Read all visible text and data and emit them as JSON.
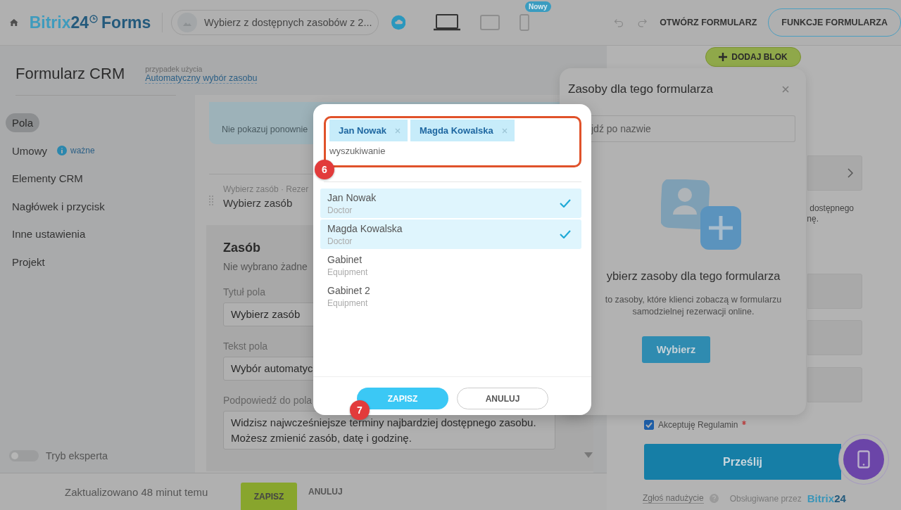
{
  "topbar": {
    "logo": {
      "brand": "Bitrix",
      "number": "24",
      "product": "Forms"
    },
    "page_select": "Wybierz z dostępnych zasobów z 2...",
    "devices": [
      {
        "kind": "laptop",
        "selected": true
      },
      {
        "kind": "tablet",
        "selected": false
      },
      {
        "kind": "phone",
        "selected": false,
        "badge": "Nowy"
      }
    ],
    "open_link": "OTWÓRZ FORMULARZ",
    "features_button": "FUNKCJE FORMULARZA"
  },
  "sidebar": {
    "title": "Formularz CRM",
    "use_case_label": "przypadek użycia",
    "use_case": "Automatyczny wybór zasobu",
    "items": [
      {
        "label": "Pola",
        "selected": true
      },
      {
        "label": "Umowy",
        "selected": false,
        "note": "ważne"
      },
      {
        "label": "Elementy CRM",
        "selected": false
      },
      {
        "label": "Nagłówek i przycisk",
        "selected": false
      },
      {
        "label": "Inne ustawienia",
        "selected": false
      },
      {
        "label": "Projekt",
        "selected": false
      }
    ],
    "expert_mode": {
      "label": "Tryb eksperta",
      "on": false
    }
  },
  "editor": {
    "notice": "Nie pokazuj ponownie",
    "field_path": "Wybierz zasób · Rezer",
    "field_name": "Wybierz zasób",
    "section": {
      "title": "Zasób",
      "subtitle": "Nie wybrano żadne",
      "fields": [
        {
          "label": "Tytuł pola",
          "lines": [
            "Wybierz zasób"
          ]
        },
        {
          "label": "Tekst pola",
          "lines": [
            "Wybór automatyc"
          ]
        },
        {
          "label": "Podpowiedź do pola",
          "lines": [
            "Widzisz najwcześniejsze terminy najbardziej dostępnego zasobu.",
            "Możesz zmienić zasób, datę i godzinę."
          ]
        }
      ]
    }
  },
  "bottom_bar": {
    "status": "Zaktualizowano 48 minut temu",
    "save": "ZAPISZ",
    "cancel": "ANULUJ"
  },
  "preview": {
    "add_block": "DODAJ BLOK",
    "fragments": [
      "dostępnego",
      "nę."
    ],
    "terms": {
      "label": "Akceptuję Regulamin",
      "required": true,
      "checked": true
    },
    "submit": "Prześlij",
    "report": "Zgłoś nadużycie",
    "powered_by": "Obsługiwane przez",
    "powered_brand": "Bitrix",
    "powered_number": "24"
  },
  "resources_panel": {
    "title": "Zasoby dla tego formularza",
    "search_placeholder": "jdź po nazwie",
    "empty_title": "ybierz zasoby dla tego formularza",
    "empty_text": [
      "to zasoby, które klienci zobaczą w formularzu",
      "samodzielnej rezerwacji online."
    ],
    "choose": "Wybierz"
  },
  "dialog": {
    "tags": [
      "Jan Nowak",
      "Magda Kowalska"
    ],
    "search_placeholder": "wyszukiwanie",
    "options": [
      {
        "name": "Jan Nowak",
        "type": "Doctor",
        "selected": true
      },
      {
        "name": "Magda Kowalska",
        "type": "Doctor",
        "selected": true
      },
      {
        "name": "Gabinet",
        "type": "Equipment",
        "selected": false
      },
      {
        "name": "Gabinet 2",
        "type": "Equipment",
        "selected": false
      }
    ],
    "save": "ZAPISZ",
    "cancel": "ANULUJ"
  },
  "callouts": [
    {
      "number": "6"
    },
    {
      "number": "7"
    }
  ]
}
